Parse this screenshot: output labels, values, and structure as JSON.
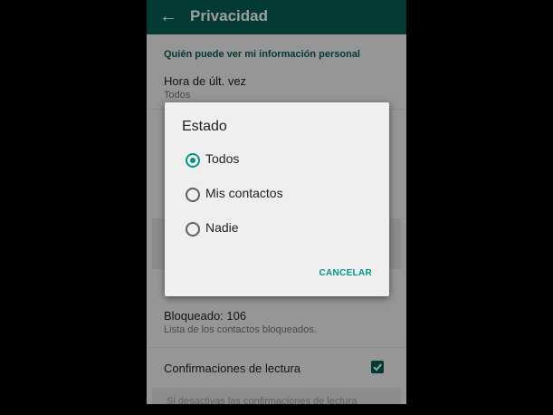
{
  "appbar": {
    "title": "Privacidad",
    "back_icon": "arrow-left-icon"
  },
  "section": {
    "header": "Quién puede ver mi información personal"
  },
  "last_seen": {
    "title": "Hora de últ. vez",
    "value": "Todos"
  },
  "blocked": {
    "title": "Bloqueado: 106",
    "subtitle": "Lista de los contactos bloqueados."
  },
  "read_receipts": {
    "title": "Confirmaciones de lectura",
    "checked": true
  },
  "footer_hint": "Si desactivas las confirmaciones de lectura",
  "dialog": {
    "title": "Estado",
    "options": [
      {
        "label": "Todos",
        "selected": true
      },
      {
        "label": "Mis contactos",
        "selected": false
      },
      {
        "label": "Nadie",
        "selected": false
      }
    ],
    "cancel_label": "CANCELAR"
  },
  "colors": {
    "primary": "#075e54",
    "accent": "#009688"
  }
}
